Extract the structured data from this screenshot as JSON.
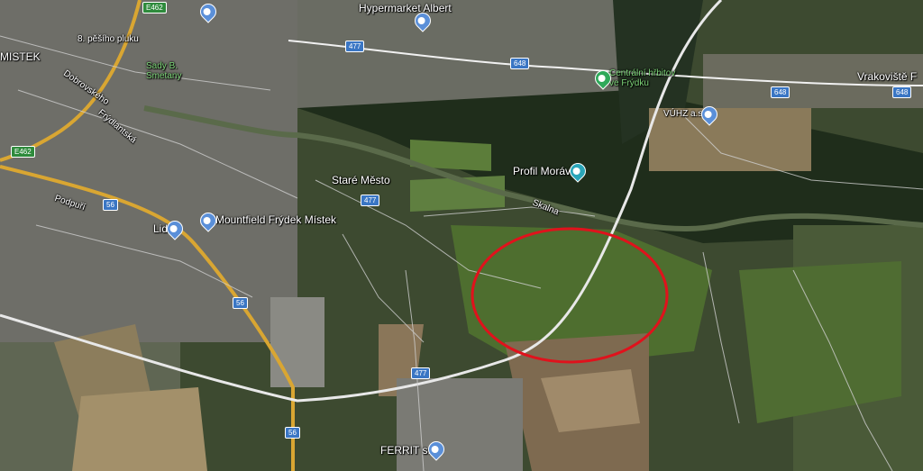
{
  "map": {
    "places": {
      "mistek": "MISTEK",
      "hypermarket": "Hypermarket Albert",
      "sady": "Sady B.\nSmetany",
      "hrbitov": "Centrální hřbitov\nve Frýdku",
      "vrakoviste": "Vrakoviště F",
      "vuhz": "VÚHZ a.s",
      "profil": "Profil Morávky",
      "stare_mesto": "Staré Město",
      "lidl": "Lidl",
      "mountfield": "Mountfield Frýdek Místek",
      "ferrit": "FERRIT s.r.o",
      "pesiho": "8. pěšího pluku",
      "dobrovskeho": "Dobrovského",
      "frydlantska": "Frýdlantská",
      "podpuri": "Podpuří",
      "skalna": "Skalna"
    },
    "roads": {
      "e462": "E462",
      "r477": "477",
      "r648": "648",
      "r56": "56"
    },
    "annotation": {
      "shape": "ellipse",
      "color": "#e0121c"
    }
  }
}
